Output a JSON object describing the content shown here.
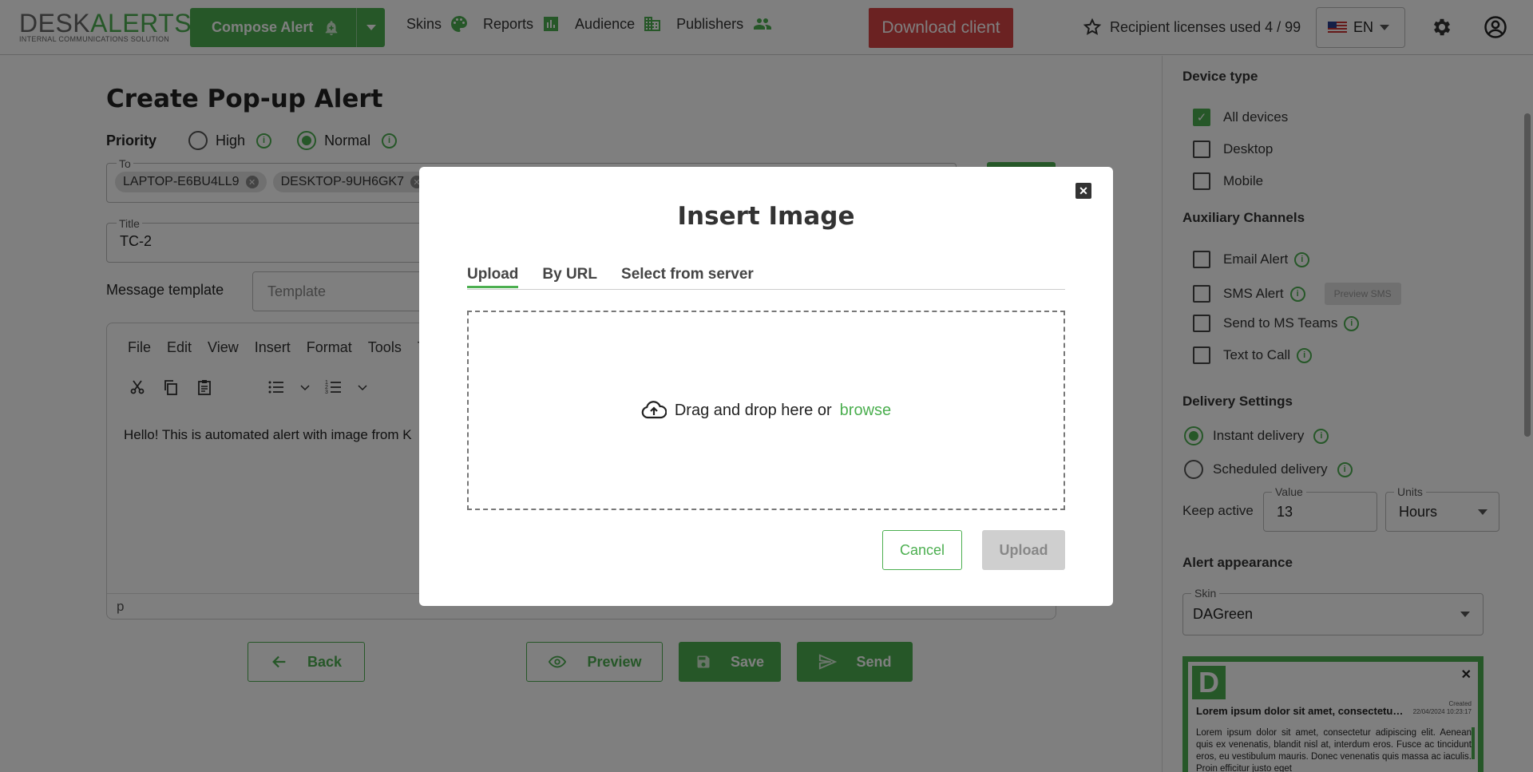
{
  "brand": {
    "logo_desk": "DESK",
    "logo_alerts": "ALERTS",
    "tagline": "INTERNAL COMMUNICATIONS SOLUTION",
    "accent_color": "#4caf50",
    "danger_color": "#d64545"
  },
  "topbar": {
    "compose_label": "Compose Alert",
    "nav": [
      {
        "label": "Skins",
        "icon": "palette-icon"
      },
      {
        "label": "Reports",
        "icon": "bar-chart-icon"
      },
      {
        "label": "Audience",
        "icon": "domain-icon"
      },
      {
        "label": "Publishers",
        "icon": "people-icon"
      }
    ],
    "download_label": "Download client",
    "licenses_label": "Recipient licenses used 4 / 99",
    "language": "EN"
  },
  "page": {
    "title": "Create Pop-up Alert",
    "priority_label": "Priority",
    "priority_options": [
      "High",
      "Normal"
    ],
    "priority_selected": "Normal",
    "to_label": "To",
    "recipients": [
      "LAPTOP-E6BU4LL9",
      "DESKTOP-9UH6GK7"
    ],
    "title_label": "Title",
    "title_value": "TC-2",
    "template_label": "Message template",
    "template_placeholder": "Template",
    "editor_menu": [
      "File",
      "Edit",
      "View",
      "Insert",
      "Format",
      "Tools",
      "T"
    ],
    "editor_text": "Hello! This is automated alert with image from K",
    "editor_status": "p",
    "back_label": "Back",
    "preview_label": "Preview",
    "save_label": "Save",
    "send_label": "Send"
  },
  "sidebar": {
    "device_type_heading": "Device type",
    "devices": [
      {
        "label": "All devices",
        "checked": true
      },
      {
        "label": "Desktop",
        "checked": false
      },
      {
        "label": "Mobile",
        "checked": false
      }
    ],
    "aux_heading": "Auxiliary Channels",
    "aux": [
      {
        "label": "Email Alert",
        "checked": false
      },
      {
        "label": "SMS Alert",
        "checked": false
      },
      {
        "label": "Send to MS Teams",
        "checked": false
      },
      {
        "label": "Text to Call",
        "checked": false
      }
    ],
    "preview_sms_label": "Preview SMS",
    "delivery_heading": "Delivery Settings",
    "delivery_options": [
      "Instant delivery",
      "Scheduled delivery"
    ],
    "delivery_selected": "Instant delivery",
    "keep_active_label": "Keep active",
    "value_label": "Value",
    "value": "13",
    "units_label": "Units",
    "units": "Hours",
    "appearance_heading": "Alert appearance",
    "skin_label": "Skin",
    "skin": "DAGreen",
    "preview": {
      "logo_letter": "D",
      "title": "Lorem ipsum dolor sit amet, consectetur adipiscing",
      "created_label": "Created",
      "created_date": "22/04/2024 10:23:17",
      "body": "Lorem ipsum dolor sit amet, consectetur adipiscing elit. Aenean quis ex venenatis, blandit nisl at, interdum eros. Fusce ac tincidunt eros, eu vestibulum mauris. Donec venenatis quis massa ac iaculis. Proin efficitur justo eget"
    }
  },
  "modal": {
    "title": "Insert Image",
    "tabs": [
      "Upload",
      "By URL",
      "Select from server"
    ],
    "active_tab": "Upload",
    "drop_text": "Drag and drop here or",
    "browse_text": "browse",
    "cancel_label": "Cancel",
    "upload_label": "Upload"
  }
}
